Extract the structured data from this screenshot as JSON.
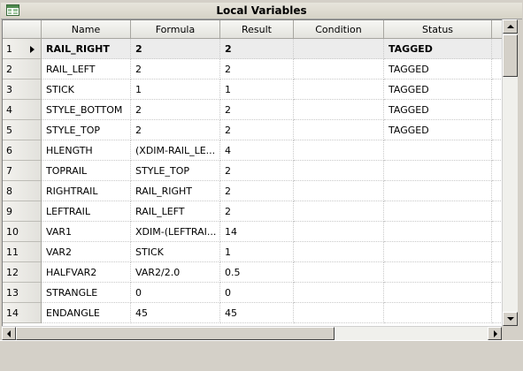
{
  "window": {
    "title": "Local Variables"
  },
  "grid": {
    "columns": [
      "Name",
      "Formula",
      "Result",
      "Condition",
      "Status"
    ],
    "rows": [
      {
        "num": "1",
        "name": "RAIL_RIGHT",
        "formula": "2",
        "result": "2",
        "condition": "",
        "status": "TAGGED"
      },
      {
        "num": "2",
        "name": "RAIL_LEFT",
        "formula": "2",
        "result": "2",
        "condition": "",
        "status": "TAGGED"
      },
      {
        "num": "3",
        "name": "STICK",
        "formula": "1",
        "result": "1",
        "condition": "",
        "status": "TAGGED"
      },
      {
        "num": "4",
        "name": "STYLE_BOTTOM",
        "formula": "2",
        "result": "2",
        "condition": "",
        "status": "TAGGED"
      },
      {
        "num": "5",
        "name": "STYLE_TOP",
        "formula": "2",
        "result": "2",
        "condition": "",
        "status": "TAGGED"
      },
      {
        "num": "6",
        "name": "HLENGTH",
        "formula": "(XDIM-RAIL_LE...",
        "result": "4",
        "condition": "",
        "status": ""
      },
      {
        "num": "7",
        "name": "TOPRAIL",
        "formula": "STYLE_TOP",
        "result": "2",
        "condition": "",
        "status": ""
      },
      {
        "num": "8",
        "name": "RIGHTRAIL",
        "formula": "RAIL_RIGHT",
        "result": "2",
        "condition": "",
        "status": ""
      },
      {
        "num": "9",
        "name": "LEFTRAIL",
        "formula": "RAIL_LEFT",
        "result": "2",
        "condition": "",
        "status": ""
      },
      {
        "num": "10",
        "name": "VAR1",
        "formula": "XDIM-(LEFTRAI...",
        "result": "14",
        "condition": "",
        "status": ""
      },
      {
        "num": "11",
        "name": "VAR2",
        "formula": "STICK",
        "result": "1",
        "condition": "",
        "status": ""
      },
      {
        "num": "12",
        "name": "HALFVAR2",
        "formula": "VAR2/2.0",
        "result": "0.5",
        "condition": "",
        "status": ""
      },
      {
        "num": "13",
        "name": "STRANGLE",
        "formula": "0",
        "result": "0",
        "condition": "",
        "status": ""
      },
      {
        "num": "14",
        "name": "ENDANGLE",
        "formula": "45",
        "result": "45",
        "condition": "",
        "status": ""
      }
    ]
  },
  "colors": {
    "header_bg": "#e3e2dd",
    "current_row_bg": "#ececec",
    "window_bg": "#d4d0c8"
  }
}
